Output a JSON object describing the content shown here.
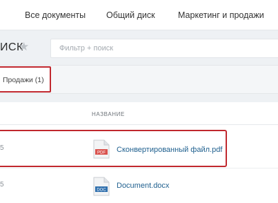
{
  "nav": {
    "tabs": [
      {
        "label": "Все документы"
      },
      {
        "label": "Общий диск"
      },
      {
        "label": "Маркетинг и продажи"
      }
    ]
  },
  "header": {
    "title": "ИСК",
    "star_icon": "star-icon",
    "filter_placeholder": "Фильтр + поиск"
  },
  "filter_chip": {
    "label": "Продажи (1)"
  },
  "table": {
    "column_name": "НАЗВАНИЕ",
    "rows": [
      {
        "marker": "5",
        "icon": "pdf-file-icon",
        "icon_label": "PDF",
        "icon_color": "#d9534f",
        "name": "Сконвертированный файл.pdf",
        "selected": true
      },
      {
        "marker": "5",
        "icon": "docx-file-icon",
        "icon_label": "DOC",
        "icon_color": "#2f6fad",
        "name": "Document.docx",
        "selected": false
      }
    ]
  },
  "colors": {
    "accent_red": "#c0272d",
    "link": "#1e5f8e"
  }
}
